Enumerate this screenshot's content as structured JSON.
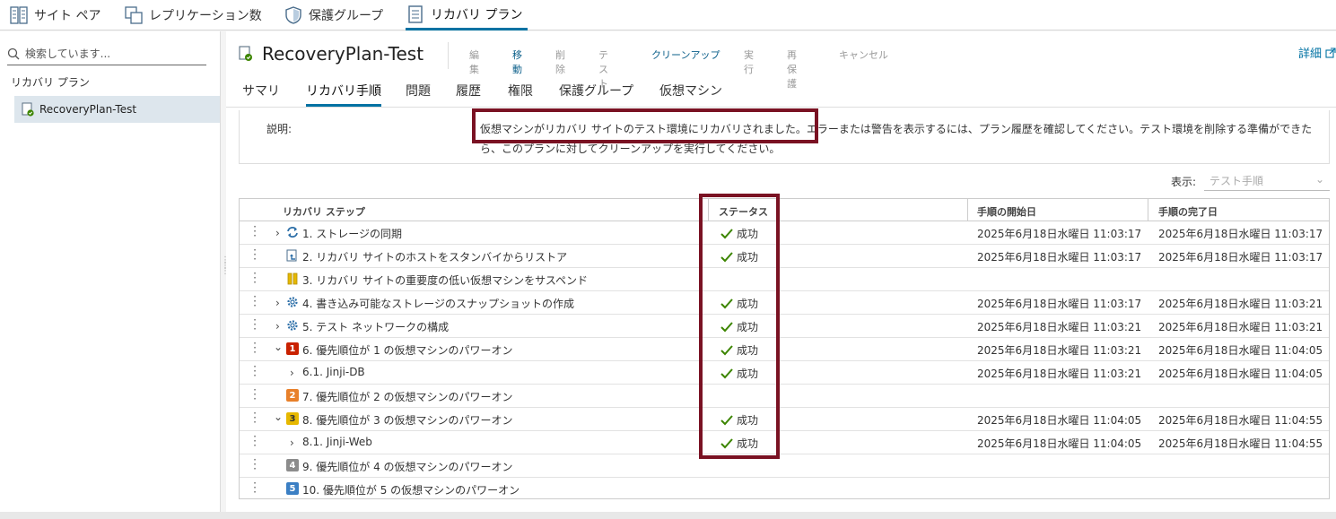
{
  "topnav": {
    "tabs": [
      {
        "label": "サイト ペア",
        "icon": "building-icon"
      },
      {
        "label": "レプリケーション数",
        "icon": "copy-icon"
      },
      {
        "label": "保護グループ",
        "icon": "shield-icon"
      },
      {
        "label": "リカバリ プラン",
        "icon": "document-icon",
        "active": true
      }
    ]
  },
  "sidebar": {
    "search_placeholder": "検索しています...",
    "heading": "リカバリ プラン",
    "items": [
      {
        "label": "RecoveryPlan-Test",
        "selected": true
      }
    ]
  },
  "header": {
    "title": "RecoveryPlan-Test",
    "actions": [
      {
        "label": "編集",
        "enabled": false
      },
      {
        "label": "移動",
        "enabled": true
      },
      {
        "label": "削除",
        "enabled": false
      },
      {
        "label": "テスト",
        "enabled": false
      },
      {
        "label": "クリーンアップ",
        "enabled": true
      },
      {
        "label": "実行",
        "enabled": false
      },
      {
        "label": "再保護",
        "enabled": false
      },
      {
        "label": "キャンセル",
        "enabled": false
      }
    ],
    "details_label": "詳細"
  },
  "subtabs": [
    {
      "label": "サマリ"
    },
    {
      "label": "リカバリ手順",
      "active": true
    },
    {
      "label": "問題"
    },
    {
      "label": "履歴"
    },
    {
      "label": "権限"
    },
    {
      "label": "保護グループ"
    },
    {
      "label": "仮想マシン"
    }
  ],
  "description": {
    "label": "説明:",
    "text": "仮想マシンがリカバリ サイトのテスト環境にリカバリされました。エラーまたは警告を表示するには、プラン履歴を確認してください。テスト環境を削除する準備ができたら、このプランに対してクリーンアップを実行してください。"
  },
  "view": {
    "label": "表示:",
    "value": "テスト手順"
  },
  "table": {
    "columns": [
      "リカバリ ステップ",
      "ステータス",
      "手順の開始日",
      "手順の完了日"
    ],
    "rows": [
      {
        "name": "1. ストレージの同期",
        "expander": ">",
        "icon": "sync-icon",
        "status": "成功",
        "start": "2025年6月18日水曜日 11:03:17",
        "end": "2025年6月18日水曜日 11:03:17"
      },
      {
        "name": "2. リカバリ サイトのホストをスタンバイからリストア",
        "expander": "",
        "icon": "host-restore-icon",
        "status": "成功",
        "start": "2025年6月18日水曜日 11:03:17",
        "end": "2025年6月18日水曜日 11:03:17"
      },
      {
        "name": "3. リカバリ サイトの重要度の低い仮想マシンをサスペンド",
        "expander": "",
        "icon": "pause-icon",
        "status": "",
        "start": "",
        "end": ""
      },
      {
        "name": "4. 書き込み可能なストレージのスナップショットの作成",
        "expander": ">",
        "icon": "gear-icon",
        "status": "成功",
        "start": "2025年6月18日水曜日 11:03:17",
        "end": "2025年6月18日水曜日 11:03:21"
      },
      {
        "name": "5. テスト ネットワークの構成",
        "expander": ">",
        "icon": "gear-icon",
        "status": "成功",
        "start": "2025年6月18日水曜日 11:03:21",
        "end": "2025年6月18日水曜日 11:03:21"
      },
      {
        "name": "6. 優先順位が 1 の仮想マシンのパワーオン",
        "expander": "v",
        "icon": "priority-1-icon",
        "badge": "1",
        "badge_color": "#c92100",
        "status": "成功",
        "start": "2025年6月18日水曜日 11:03:21",
        "end": "2025年6月18日水曜日 11:04:05"
      },
      {
        "name": "6.1. Jinji-DB",
        "expander": ">",
        "child": true,
        "status": "成功",
        "start": "2025年6月18日水曜日 11:03:21",
        "end": "2025年6月18日水曜日 11:04:05"
      },
      {
        "name": "7. 優先順位が 2 の仮想マシンのパワーオン",
        "expander": "",
        "icon": "priority-2-icon",
        "badge": "2",
        "badge_color": "#e8802a",
        "status": "",
        "start": "",
        "end": ""
      },
      {
        "name": "8. 優先順位が 3 の仮想マシンのパワーオン",
        "expander": "v",
        "icon": "priority-3-icon",
        "badge": "3",
        "badge_color": "#e6b800",
        "status": "成功",
        "start": "2025年6月18日水曜日 11:04:05",
        "end": "2025年6月18日水曜日 11:04:55"
      },
      {
        "name": "8.1. Jinji-Web",
        "expander": ">",
        "child": true,
        "status": "成功",
        "start": "2025年6月18日水曜日 11:04:05",
        "end": "2025年6月18日水曜日 11:04:55"
      },
      {
        "name": "9. 優先順位が 4 の仮想マシンのパワーオン",
        "expander": "",
        "icon": "priority-4-icon",
        "badge": "4",
        "badge_color": "#8c8c8c",
        "status": "",
        "start": "",
        "end": ""
      },
      {
        "name": "10. 優先順位が 5 の仮想マシンのパワーオン",
        "expander": "",
        "icon": "priority-5-icon",
        "badge": "5",
        "badge_color": "#3b7fc4",
        "status": "",
        "start": "",
        "end": ""
      }
    ]
  },
  "colors": {
    "accent": "#0072a3",
    "highlight": "#7a1223",
    "success": "#3c8500"
  }
}
